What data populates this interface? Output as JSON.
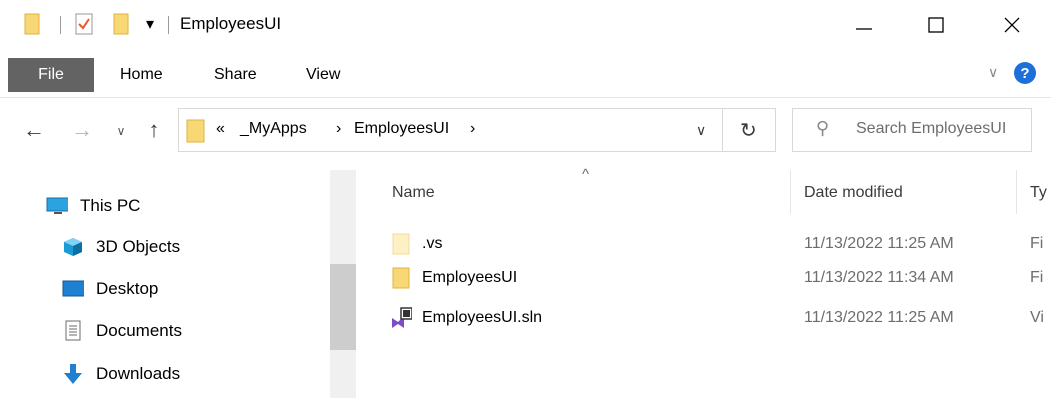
{
  "window": {
    "title": "EmployeesUI",
    "controls": {
      "minimize": "—",
      "maximize": "☐",
      "close": "✕"
    }
  },
  "quick_access": {
    "dropdown_glyph": "▾"
  },
  "ribbon": {
    "tabs": [
      "File",
      "Home",
      "Share",
      "View"
    ],
    "expand_glyph": "∨",
    "help_glyph": "?"
  },
  "nav": {
    "back_glyph": "←",
    "forward_glyph": "→",
    "recent_glyph": "∨",
    "up_glyph": "↑"
  },
  "address": {
    "overflow": "«",
    "crumbs": [
      "_MyApps",
      "EmployeesUI"
    ],
    "separator": "›",
    "dropdown_glyph": "∨",
    "refresh_glyph": "↻"
  },
  "search": {
    "placeholder": "Search EmployeesUI",
    "icon_glyph": "⚲"
  },
  "nav_pane": {
    "scroll_up_glyph": "^",
    "items": [
      {
        "label": "This PC",
        "icon": "this-pc-icon"
      },
      {
        "label": "3D Objects",
        "icon": "3d-objects-icon"
      },
      {
        "label": "Desktop",
        "icon": "desktop-icon"
      },
      {
        "label": "Documents",
        "icon": "documents-icon"
      },
      {
        "label": "Downloads",
        "icon": "downloads-icon"
      }
    ]
  },
  "file_list": {
    "sort_glyph": "^",
    "columns": [
      "Name",
      "Date modified",
      "Ty"
    ],
    "rows": [
      {
        "name": ".vs",
        "date": "11/13/2022 11:25 AM",
        "type": "Fi",
        "icon": "hidden-folder-icon"
      },
      {
        "name": "EmployeesUI",
        "date": "11/13/2022 11:34 AM",
        "type": "Fi",
        "icon": "folder-icon"
      },
      {
        "name": "EmployeesUI.sln",
        "date": "11/13/2022 11:25 AM",
        "type": "Vi",
        "icon": "solution-file-icon"
      }
    ]
  },
  "colors": {
    "folder": "#f8d775",
    "folder_dark": "#e8b840",
    "help": "#1e6fd9",
    "file_tab": "#636363"
  }
}
